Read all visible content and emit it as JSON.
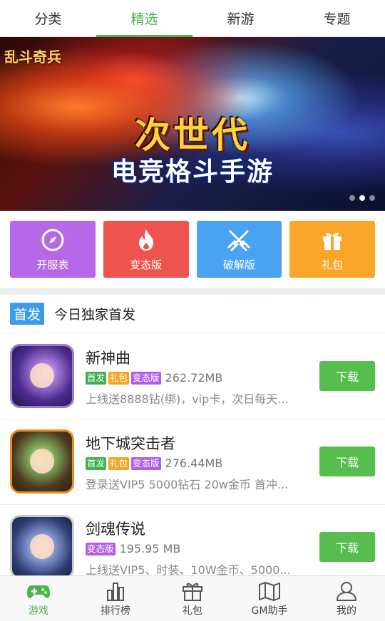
{
  "tabs": [
    {
      "label": "分类"
    },
    {
      "label": "精选"
    },
    {
      "label": "新游"
    },
    {
      "label": "专题"
    }
  ],
  "banner": {
    "logo": "乱斗奇兵",
    "title_line1": "次世代",
    "title_line2": "电竞格斗手游",
    "active_dot": 2,
    "dot_count": 3
  },
  "categories": [
    {
      "label": "开服表",
      "icon": "compass-icon",
      "color": "#b569e8"
    },
    {
      "label": "变态版",
      "icon": "flame-icon",
      "color": "#ef5350"
    },
    {
      "label": "破解版",
      "icon": "crossed-swords-icon",
      "color": "#4aa3f0"
    },
    {
      "label": "礼包",
      "icon": "gift-icon",
      "color": "#f9a62a"
    }
  ],
  "section": {
    "badge": "首发",
    "title": "今日独家首发"
  },
  "games": [
    {
      "name": "新神曲",
      "tags": [
        "首发",
        "礼包",
        "变态版"
      ],
      "size": "262.72MB",
      "desc": "上线送8888钻(绑)，vip卡，次日每天...",
      "button": "下载"
    },
    {
      "name": "地下城突击者",
      "tags": [
        "首发",
        "礼包",
        "变态版"
      ],
      "size": "276.44MB",
      "desc": "登录送VIP5 5000钻石 20w金币 首冲...",
      "button": "下载"
    },
    {
      "name": "剑魂传说",
      "tags": [
        "变态版"
      ],
      "size": "195.95 MB",
      "desc": "上线送VIP5、时装、10W金币、5000...",
      "button": "下载"
    }
  ],
  "bottom_nav": [
    {
      "label": "游戏",
      "icon": "gamepad-icon"
    },
    {
      "label": "排行榜",
      "icon": "bar-chart-icon"
    },
    {
      "label": "礼包",
      "icon": "gift-icon"
    },
    {
      "label": "GM助手",
      "icon": "map-icon"
    },
    {
      "label": "我的",
      "icon": "user-icon"
    }
  ],
  "colors": {
    "accent": "#4bb44a",
    "download": "#58bd4f",
    "tag_green": "#3fb24f",
    "tag_orange": "#f7a324",
    "tag_purple": "#b15ee6",
    "section_badge": "#3d9be9"
  }
}
